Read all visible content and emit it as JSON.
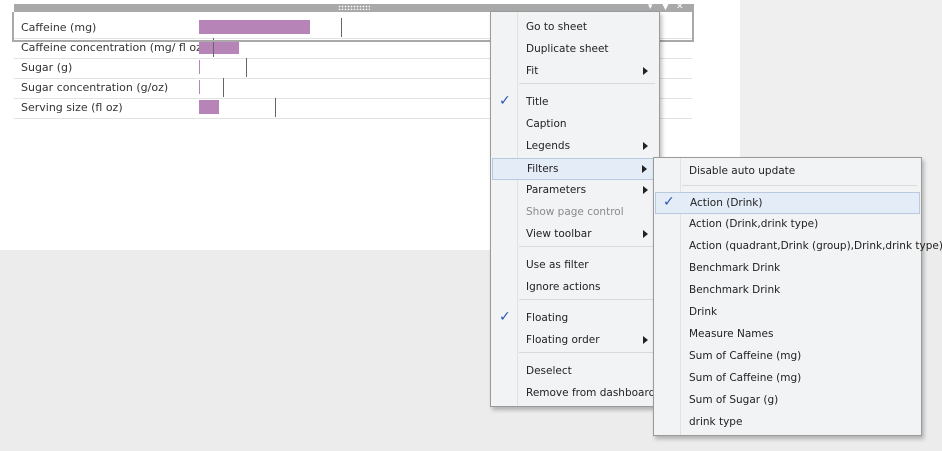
{
  "sheet": {
    "toolbar_icons": [
      "dropdown-icon",
      "filter-icon",
      "close-icon"
    ],
    "rows": [
      {
        "label": "Caffeine (mg)",
        "bar": 0.226,
        "marker": 0.29
      },
      {
        "label": "Caffeine concentration (mg/ fl oz)",
        "bar": 0.082,
        "marker": 0.028
      },
      {
        "label": "Sugar (g)",
        "bar": 0.002,
        "marker": 0.096
      },
      {
        "label": "Sugar concentration (g/oz)",
        "bar": 0.002,
        "marker": 0.048
      },
      {
        "label": "Serving size (fl oz)",
        "bar": 0.04,
        "marker": 0.156
      }
    ],
    "bar_color": "#b784b7"
  },
  "context_menu": {
    "items": [
      {
        "label": "Go to sheet"
      },
      {
        "label": "Duplicate sheet"
      },
      {
        "label": "Fit",
        "submenu": true
      },
      {
        "label": "Title",
        "checked": true
      },
      {
        "label": "Caption"
      },
      {
        "label": "Legends",
        "submenu": true
      },
      {
        "label": "Filters",
        "submenu": true,
        "highlighted": true
      },
      {
        "label": "Parameters",
        "submenu": true
      },
      {
        "label": "Show page control",
        "disabled": true
      },
      {
        "label": "View toolbar",
        "submenu": true
      },
      {
        "label": "Use as filter"
      },
      {
        "label": "Ignore actions"
      },
      {
        "label": "Floating",
        "checked": true
      },
      {
        "label": "Floating order",
        "submenu": true
      },
      {
        "label": "Deselect"
      },
      {
        "label": "Remove from dashboard"
      }
    ]
  },
  "filters_submenu": {
    "items": [
      {
        "label": "Disable auto update"
      },
      {
        "label": "Action (Drink)",
        "checked": true,
        "highlighted": true
      },
      {
        "label": "Action (Drink,drink type)"
      },
      {
        "label": "Action (quadrant,Drink (group),Drink,drink type)"
      },
      {
        "label": "Benchmark Drink"
      },
      {
        "label": "Benchmark Drink"
      },
      {
        "label": "Drink"
      },
      {
        "label": "Measure Names"
      },
      {
        "label": "Sum of Caffeine (mg)"
      },
      {
        "label": "Sum of Caffeine (mg)"
      },
      {
        "label": "Sum of Sugar (g)"
      },
      {
        "label": "drink type"
      }
    ]
  }
}
